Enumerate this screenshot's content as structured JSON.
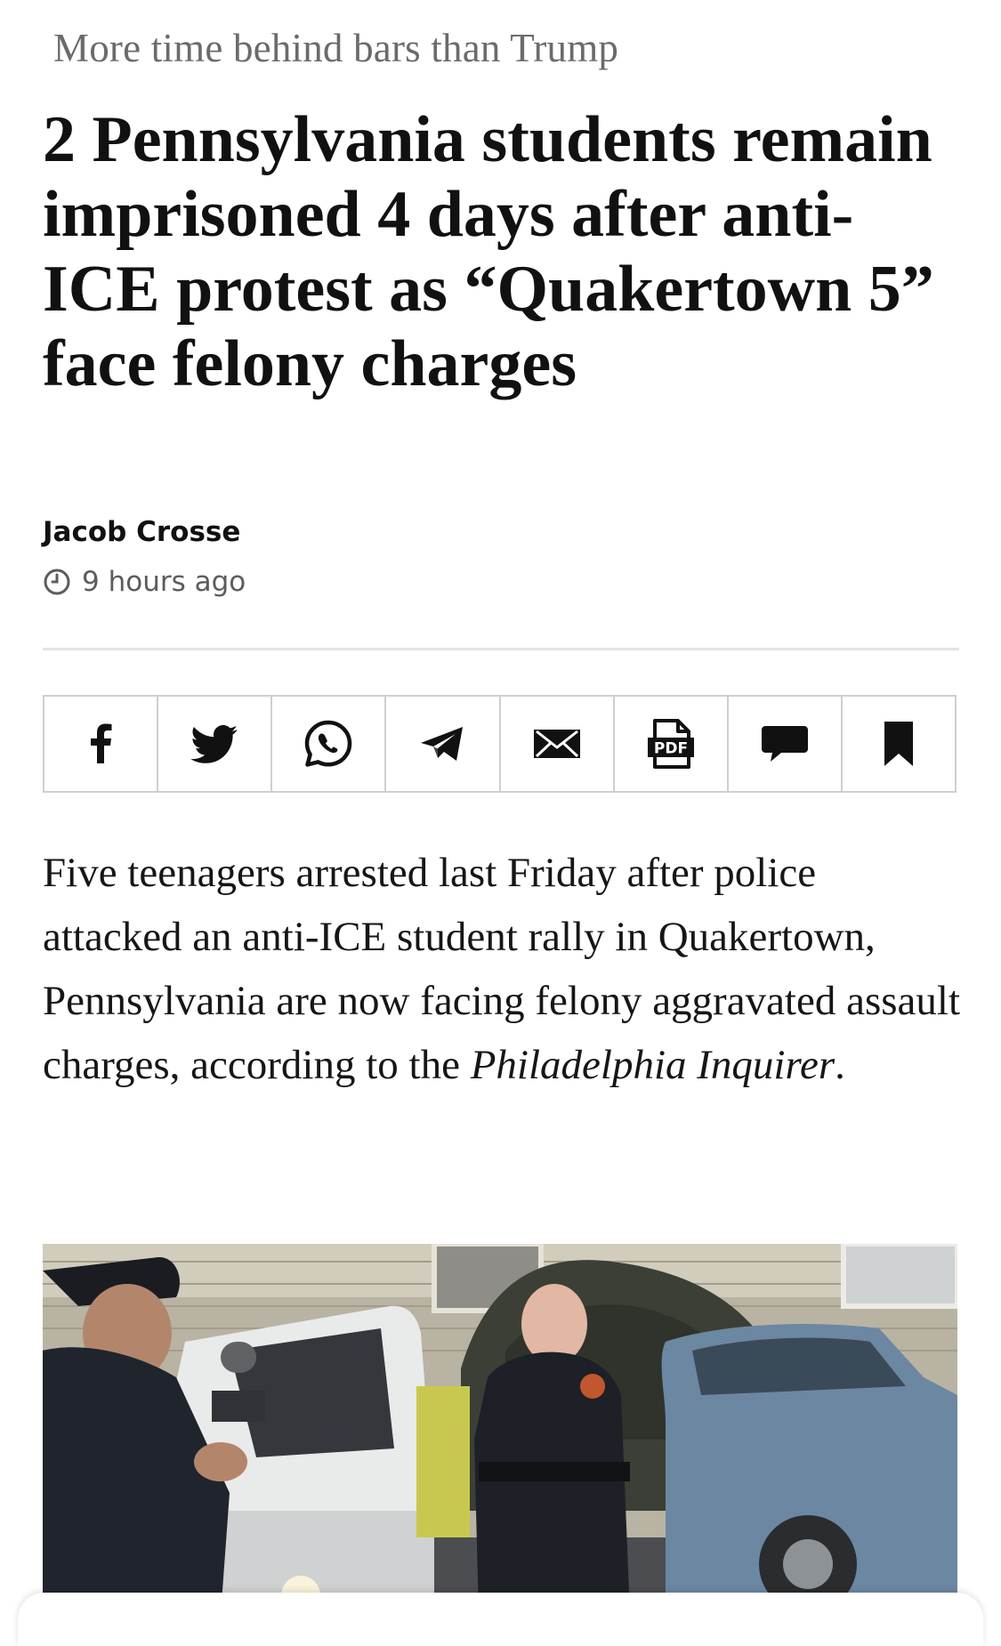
{
  "article": {
    "kicker": "More time behind bars than Trump",
    "headline": "2 Pennsylvania students remain imprisoned 4 days after anti-ICE protest as “Quakertown 5” face felony charges",
    "author": "Jacob Crosse",
    "published": "9 hours ago",
    "body": {
      "text_before": "Five teenagers arrested last Friday after police attacked an anti-ICE student rally in Quakertown, Pennsylvania are now facing felony aggravated assault charges, according to the ",
      "publication": "Philadelphia Inquirer",
      "text_after": "."
    }
  },
  "share_bar": {
    "buttons": [
      {
        "icon": "facebook-icon"
      },
      {
        "icon": "twitter-icon"
      },
      {
        "icon": "whatsapp-icon"
      },
      {
        "icon": "telegram-icon"
      },
      {
        "icon": "email-icon"
      },
      {
        "icon": "pdf-icon",
        "label": "PDF"
      },
      {
        "icon": "comment-icon"
      },
      {
        "icon": "bookmark-icon"
      }
    ]
  },
  "theme": {
    "text": "#111111",
    "kicker": "#6b6b6b",
    "meta": "#5c5c5c",
    "border": "#cfcfcf"
  }
}
